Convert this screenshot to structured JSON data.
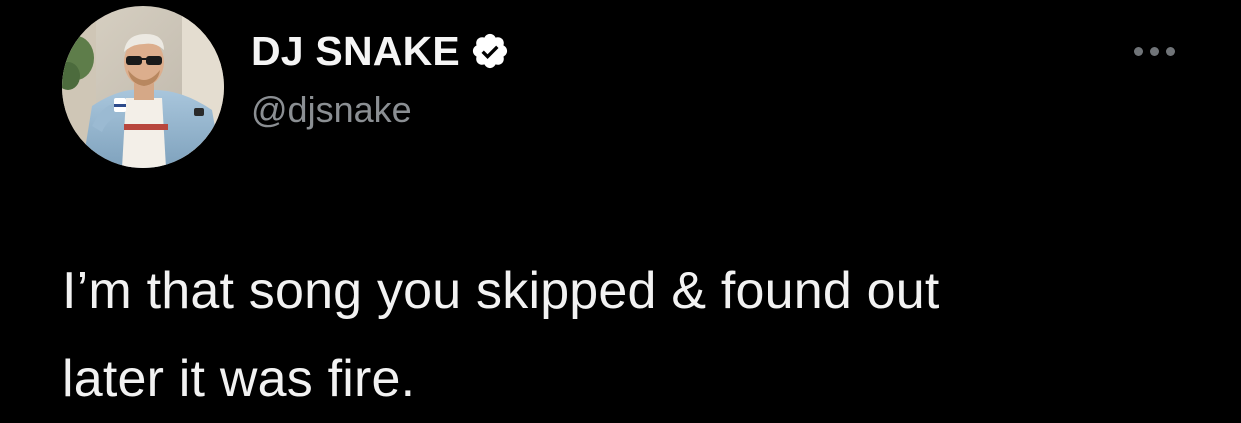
{
  "tweet": {
    "author": {
      "display_name": "DJ SNAKE",
      "handle": "@djsnake",
      "verified": true,
      "verified_icon": "verified-badge-icon",
      "avatar_icon": "profile-photo"
    },
    "text_lines": [
      "I’m that song you skipped & found out",
      "later it was fire."
    ],
    "more_icon": "more-options-icon"
  },
  "theme": {
    "background": "#000000",
    "name_color": "#f5f5f5",
    "handle_color": "#8b8f93",
    "text_color": "#f2f2f2",
    "badge_color": "#ffffff"
  }
}
